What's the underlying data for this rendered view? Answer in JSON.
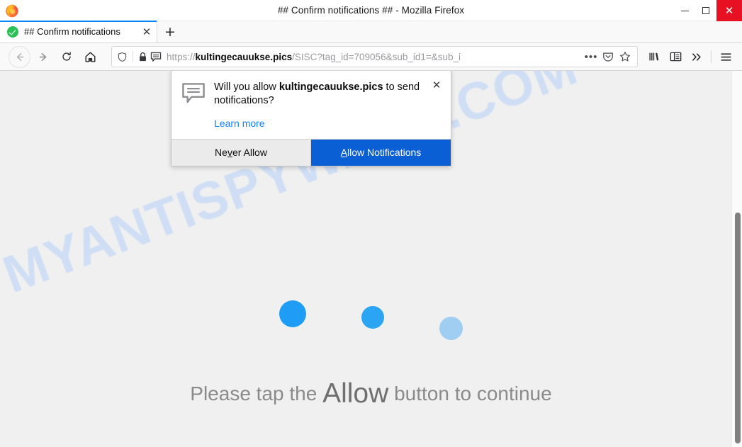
{
  "window": {
    "title": "## Confirm notifications ## - Mozilla Firefox",
    "controls": {
      "minimize": "—",
      "maximize": "☐",
      "close": "✕"
    }
  },
  "tabs": {
    "active": {
      "label": "## Confirm notifications",
      "favicon": "green-check-circle-icon",
      "close_label": "✕"
    },
    "new_tab_label": "+"
  },
  "navigation": {
    "back": "back-arrow-icon",
    "forward": "forward-arrow-icon",
    "reload": "reload-icon",
    "home": "home-icon"
  },
  "urlbar": {
    "shield_icon": "shield-icon",
    "lock_icon": "padlock-icon",
    "notification_icon": "notification-bubble-icon",
    "url_scheme": "https://",
    "url_host": "kultingecauukse.pics",
    "url_path": "/SISC?tag_id=709056&sub_id1=&sub_i",
    "page_actions": "•••",
    "save_to_pocket": "pocket-icon",
    "bookmark": "star-icon"
  },
  "toolbar_right": {
    "library": "library-icon",
    "sidebar": "sidebar-icon",
    "overflow": "»",
    "menu": "hamburger-menu-icon"
  },
  "permission_popup": {
    "icon": "speech-bubble-icon",
    "question_prefix": "Will you allow ",
    "question_host": "kultingecauukse.pics",
    "question_suffix": " to send notifications?",
    "learn_more": "Learn more",
    "close": "✕",
    "never_allow": {
      "prefix": "Ne",
      "accesskey": "v",
      "suffix": "er Allow"
    },
    "allow": {
      "accesskey": "A",
      "suffix": "llow Notifications"
    },
    "allow_button_color": "#0a5fd4"
  },
  "page": {
    "watermark": "MYANTISPYWARE.COM",
    "watermark_color": "#cadcf5",
    "message_prefix": "Please tap the ",
    "message_emphasis": "Allow",
    "message_suffix": " button to continue",
    "dots": [
      {
        "name": "loader-dot-1",
        "color": "#1f9cf5"
      },
      {
        "name": "loader-dot-2",
        "color": "#2ba4f3"
      },
      {
        "name": "loader-dot-3",
        "color": "#9fcef2"
      }
    ]
  }
}
